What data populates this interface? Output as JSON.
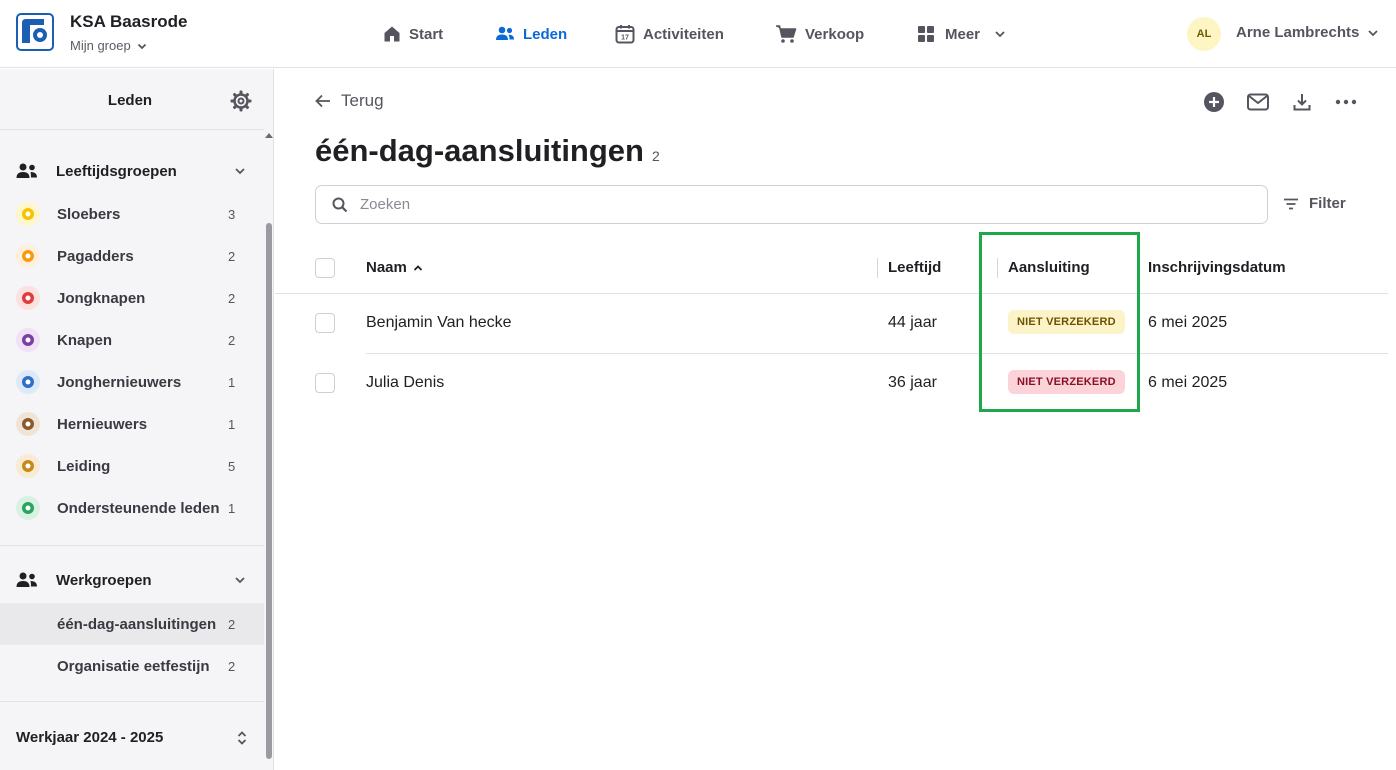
{
  "header": {
    "org_name": "KSA Baasrode",
    "group_selector": "Mijn groep",
    "nav": [
      {
        "label": "Start",
        "icon": "home-icon"
      },
      {
        "label": "Leden",
        "icon": "users-icon"
      },
      {
        "label": "Activiteiten",
        "icon": "calendar-icon"
      },
      {
        "label": "Verkoop",
        "icon": "cart-icon"
      },
      {
        "label": "Meer",
        "icon": "grid-icon"
      }
    ],
    "active_nav": "Leden",
    "user": {
      "initials": "AL",
      "name": "Arne Lambrechts"
    }
  },
  "sidebar": {
    "title": "Leden",
    "age_groups": {
      "label": "Leeftijdsgroepen",
      "items": [
        {
          "name": "Sloebers",
          "count": "3",
          "color": "#f5c400"
        },
        {
          "name": "Pagadders",
          "count": "2",
          "color": "#f39c12"
        },
        {
          "name": "Jongknapen",
          "count": "2",
          "color": "#e03c3c"
        },
        {
          "name": "Knapen",
          "count": "2",
          "color": "#7b3fa0"
        },
        {
          "name": "Jonghernieuwers",
          "count": "1",
          "color": "#2e6fc7"
        },
        {
          "name": "Hernieuwers",
          "count": "1",
          "color": "#8a5a2b"
        },
        {
          "name": "Leiding",
          "count": "5",
          "color": "#c8891b"
        },
        {
          "name": "Ondersteunende leden",
          "count": "1",
          "color": "#27a560"
        }
      ]
    },
    "work_groups": {
      "label": "Werkgroepen",
      "items": [
        {
          "name": "één-dag-aansluitingen",
          "count": "2",
          "selected": true
        },
        {
          "name": "Organisatie eetfestijn",
          "count": "2",
          "selected": false
        }
      ]
    },
    "year": "Werkjaar 2024 - 2025"
  },
  "main": {
    "back_label": "Terug",
    "title": "één-dag-aansluitingen",
    "title_count": "2",
    "search_placeholder": "Zoeken",
    "filter_label": "Filter",
    "columns": [
      "Naam",
      "Leeftijd",
      "Aansluiting",
      "Inschrijvingsdatum"
    ],
    "rows": [
      {
        "name": "Benjamin Van hecke",
        "age": "44 jaar",
        "status": "NIET VERZEKERD",
        "status_bg": "#fdf3c8",
        "status_fg": "#6b5400",
        "date": "6 mei 2025"
      },
      {
        "name": "Julia Denis",
        "age": "36 jaar",
        "status": "NIET VERZEKERD",
        "status_bg": "#fbd3d9",
        "status_fg": "#8a1026",
        "date": "6 mei 2025"
      }
    ]
  },
  "colors": {
    "accent": "#0b6bd6",
    "highlight": "#1ea84a"
  }
}
